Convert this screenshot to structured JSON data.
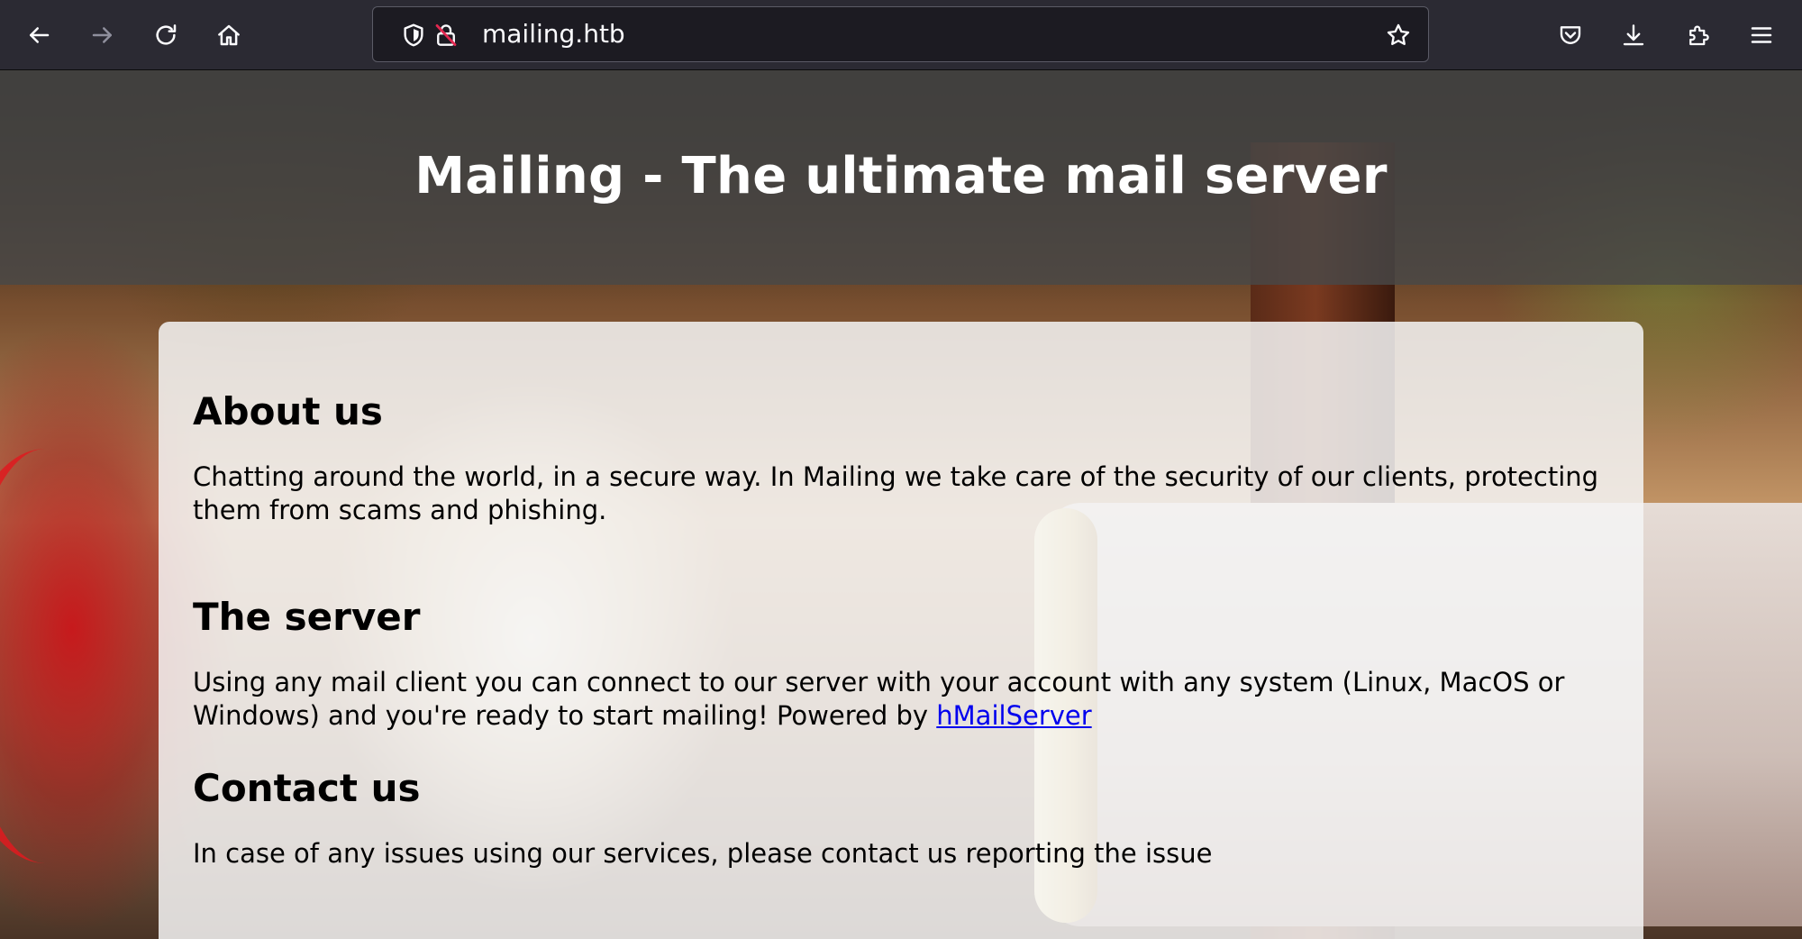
{
  "browser": {
    "url": "mailing.htb",
    "icons": {
      "back": "arrow-left-icon",
      "forward": "arrow-right-icon",
      "reload": "reload-icon",
      "home": "home-icon",
      "tracking_protection": "shield-icon",
      "insecure_lock": "lock-insecure-icon",
      "bookmark": "star-icon",
      "pocket": "pocket-icon",
      "downloads": "download-icon",
      "extensions": "puzzle-icon",
      "menu": "hamburger-menu-icon"
    },
    "colors": {
      "toolbar_bg": "#2b2a33",
      "urlbar_bg": "#1c1b22",
      "icon": "#fbfbfe",
      "icon_disabled": "#8f8f9d"
    }
  },
  "page": {
    "title": "Mailing - The ultimate mail server",
    "sections": [
      {
        "heading": "About us",
        "text": "Chatting around the world, in a secure way. In Mailing we take care of the security of our clients, protecting them from scams and phishing."
      },
      {
        "heading": "The server",
        "text_before_link": "Using any mail client you can connect to our server with your account with any system (Linux, MacOS or Windows) and you're ready to start mailing! Powered by ",
        "link_text": "hMailServer"
      },
      {
        "heading": "Contact us",
        "text": "In case of any issues using our services, please contact us reporting the issue"
      }
    ],
    "colors": {
      "header_bg": "#484848",
      "card_bg": "#f5f5f5",
      "link": "#0000ee",
      "text": "#000000"
    }
  }
}
